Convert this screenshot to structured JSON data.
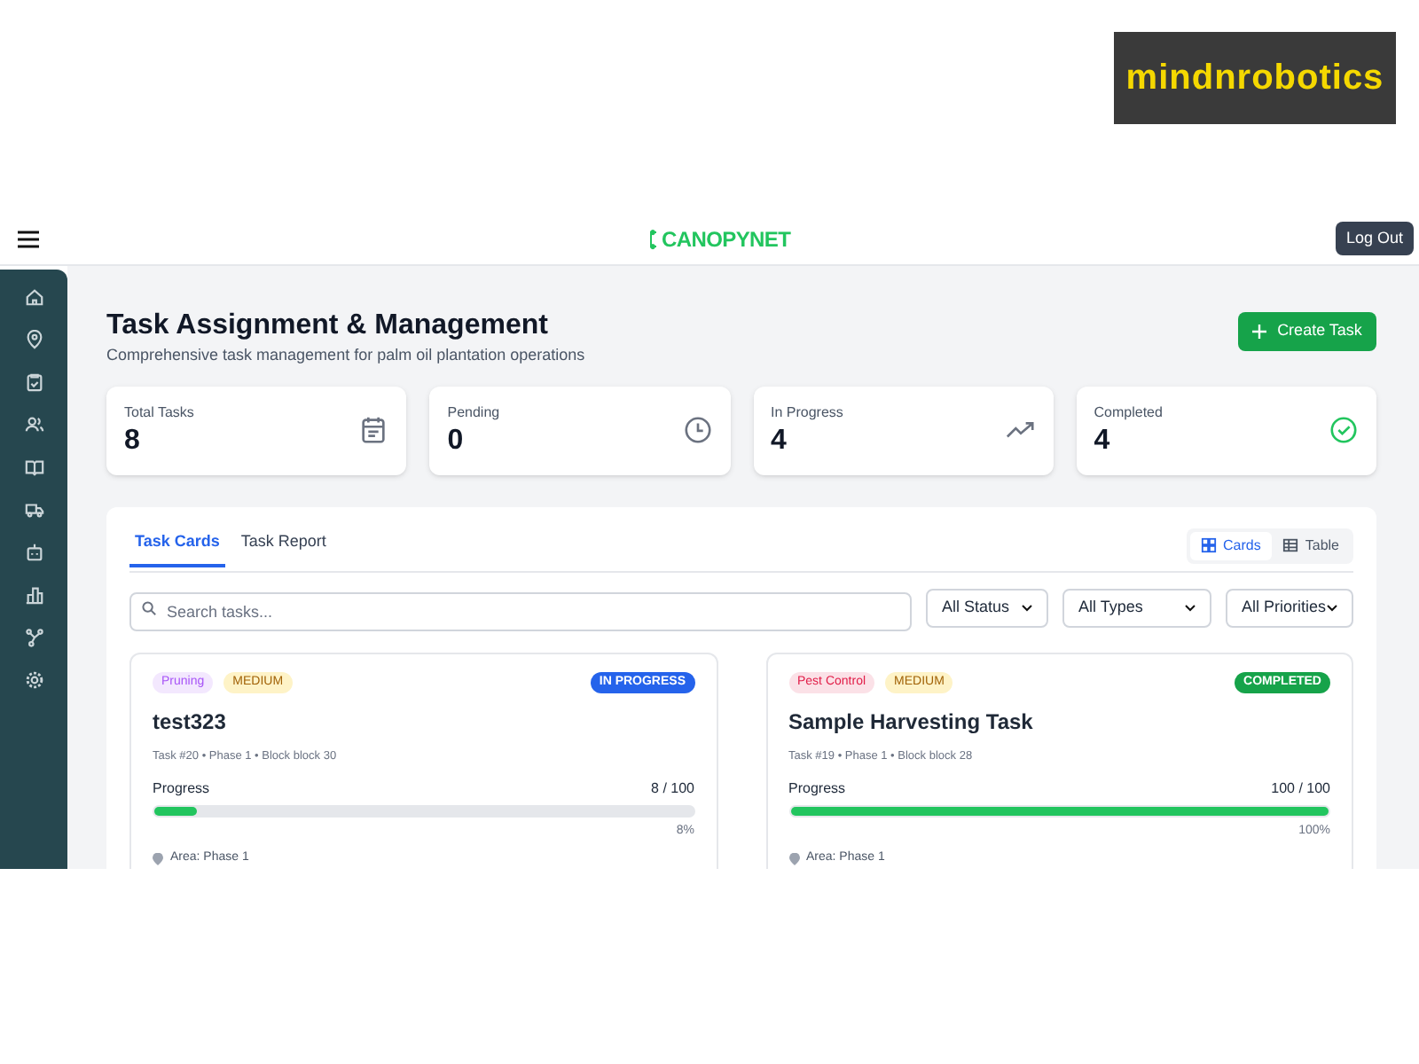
{
  "overlay_logo": {
    "text": "mindnrobotics"
  },
  "topbar": {
    "logo": "CANOPYNET",
    "logout": "Log Out"
  },
  "header": {
    "title": "Task Assignment & Management",
    "subtitle": "Comprehensive task management for palm oil plantation operations",
    "create_button": "Create Task"
  },
  "stats": [
    {
      "label": "Total Tasks",
      "value": "8"
    },
    {
      "label": "Pending",
      "value": "0"
    },
    {
      "label": "In Progress",
      "value": "4"
    },
    {
      "label": "Completed",
      "value": "4"
    }
  ],
  "tabs": [
    {
      "label": "Task Cards",
      "selected": true
    },
    {
      "label": "Task Report",
      "selected": false
    }
  ],
  "view_toggle": [
    {
      "label": "Cards",
      "selected": true
    },
    {
      "label": "Table",
      "selected": false
    }
  ],
  "search": {
    "placeholder": "Search tasks..."
  },
  "filters": [
    "All Status",
    "All Types",
    "All Priorities"
  ],
  "tasks": [
    {
      "type": "Pruning",
      "color": "#a855f7",
      "priority": "MEDIUM",
      "status": "IN PROGRESS",
      "kind": "in_progress",
      "title": "test323",
      "meta": "Task #20 • Phase 1 • Block block 30",
      "progress_label": "Progress",
      "progress_count": "8 / 100",
      "level": 0.08,
      "percent": "8%",
      "area": "Area: Phase 1"
    },
    {
      "type": "Pest Control",
      "color": "#e11d48",
      "priority": "MEDIUM",
      "status": "COMPLETED",
      "kind": "completed",
      "title": "Sample Harvesting Task",
      "meta": "Task #19 • Phase 1 • Block block 28",
      "progress_label": "Progress",
      "progress_count": "100 / 100",
      "level": 1,
      "percent": "100%",
      "area": "Area: Phase 1"
    }
  ]
}
